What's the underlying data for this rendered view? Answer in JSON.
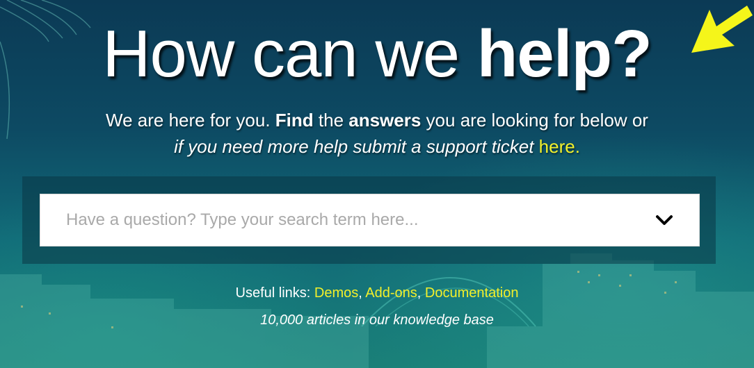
{
  "headline": {
    "regular": "How can we ",
    "bold": "help?"
  },
  "intro": {
    "part1": "We are here for you. ",
    "find": "Find",
    "the": " the ",
    "answers": "answers",
    "part2": " you are looking for below or",
    "line2": "if you need more help submit a support ticket ",
    "link": "here."
  },
  "search": {
    "placeholder": "Have a question? Type your search term here...",
    "value": ""
  },
  "icons": {
    "dropdown": "chevron-down-icon",
    "annotation": "arrow-pointer-icon"
  },
  "useful_links": {
    "label": "Useful links: ",
    "links": [
      "Demos",
      "Add-ons",
      "Documentation"
    ],
    "separator": ", "
  },
  "articles_text": "10,000 articles in our knowledge base",
  "colors": {
    "accent": "#f3f02a",
    "text": "#ffffff",
    "bg_top": "#0b3a55",
    "bg_bottom": "#1a8078"
  }
}
